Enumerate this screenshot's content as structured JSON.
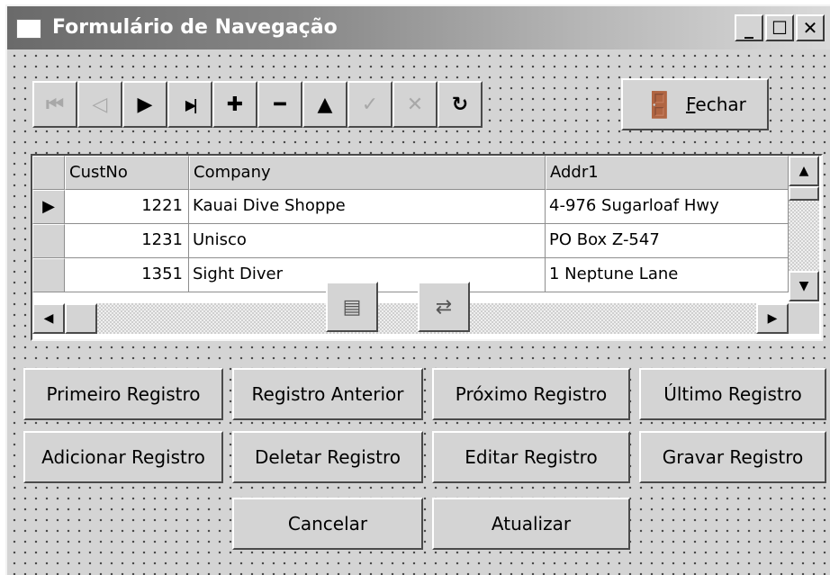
{
  "window": {
    "title": "Formulário de Navegação"
  },
  "caption_buttons": [
    {
      "name": "minimize-button",
      "glyph": "_"
    },
    {
      "name": "maximize-button",
      "glyph": "☐"
    },
    {
      "name": "close-button",
      "glyph": "✕"
    }
  ],
  "navigator": {
    "buttons": [
      {
        "name": "nav-first-button",
        "icon": "first-record-icon",
        "glyph": "⏮",
        "enabled": false
      },
      {
        "name": "nav-prior-button",
        "icon": "prior-record-icon",
        "glyph": "◁",
        "enabled": false
      },
      {
        "name": "nav-next-button",
        "icon": "next-record-icon",
        "glyph": "▶",
        "enabled": true
      },
      {
        "name": "nav-last-button",
        "icon": "last-record-icon",
        "glyph": "▶|",
        "enabled": true
      },
      {
        "name": "nav-insert-button",
        "icon": "plus-icon",
        "glyph": "✚",
        "enabled": true
      },
      {
        "name": "nav-delete-button",
        "icon": "minus-icon",
        "glyph": "━",
        "enabled": true
      },
      {
        "name": "nav-edit-button",
        "icon": "triangle-up-icon",
        "glyph": "▲",
        "enabled": true
      },
      {
        "name": "nav-post-button",
        "icon": "checkmark-icon",
        "glyph": "✓",
        "enabled": false
      },
      {
        "name": "nav-cancel-button",
        "icon": "x-icon",
        "glyph": "✕",
        "enabled": false
      },
      {
        "name": "nav-refresh-button",
        "icon": "refresh-icon",
        "glyph": "↻",
        "enabled": true
      }
    ]
  },
  "close_button": {
    "label": "Fechar",
    "accelerator": "F",
    "rest": "echar",
    "icon": "door-exit-icon"
  },
  "grid": {
    "columns": [
      "CustNo",
      "Company",
      "Addr1"
    ],
    "rows": [
      {
        "custno": "1221",
        "company": "Kauai Dive Shoppe",
        "addr1": "4-976 Sugarloaf Hwy",
        "current": true
      },
      {
        "custno": "1231",
        "company": "Unisco",
        "addr1": "PO Box Z-547",
        "current": false
      },
      {
        "custno": "1351",
        "company": "Sight Diver",
        "addr1": "1 Neptune Lane",
        "current": false
      }
    ]
  },
  "components": [
    {
      "name": "datasource-component-icon"
    },
    {
      "name": "table-component-icon"
    }
  ],
  "actions": {
    "primeiro": "Primeiro Registro",
    "anterior": "Registro Anterior",
    "proximo": "Próximo Registro",
    "ultimo": "Último Registro",
    "adicionar": "Adicionar Registro",
    "deletar": "Deletar Registro",
    "editar": "Editar Registro",
    "gravar": "Gravar Registro",
    "cancelar": "Cancelar",
    "atualizar": "Atualizar"
  },
  "colors": {
    "face": "#d4d4d4",
    "title_start": "#6a6a6a",
    "title_end": "#dadada",
    "disabled": "#a8a8a8"
  }
}
